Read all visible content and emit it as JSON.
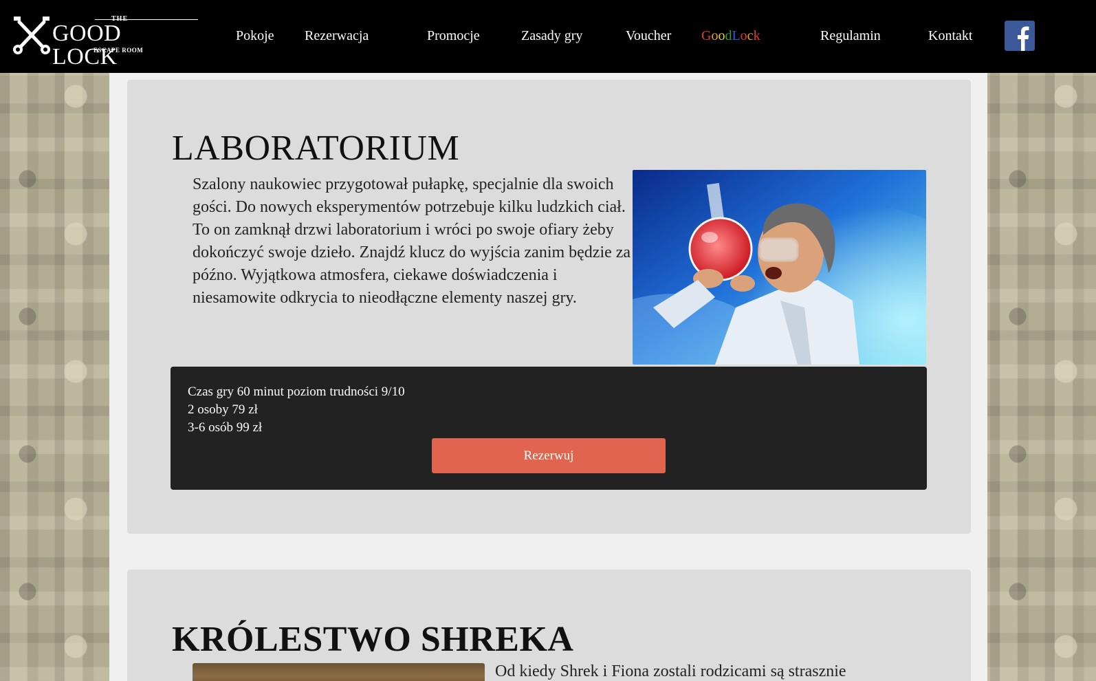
{
  "brand": {
    "the": "THE",
    "name": "GOOD LOCK",
    "sub": "ESCAPE ROOM"
  },
  "nav": {
    "items": [
      {
        "label": "Pokoje"
      },
      {
        "label": "Rezerwacja"
      },
      {
        "label": "Promocje"
      },
      {
        "label": "Zasady gry"
      },
      {
        "label": "Voucher"
      },
      {
        "label": "GoodLock",
        "letters": [
          "G",
          "o",
          "o",
          "d",
          "L",
          "o",
          "c",
          "k"
        ],
        "colors": [
          "#e03a2f",
          "#e8a020",
          "#f0d020",
          "#2a9a3a",
          "#1f5fd8",
          "#e03a2f",
          "#e8a020",
          "#e03a2f"
        ]
      },
      {
        "label": "Regulamin"
      },
      {
        "label": "Kontakt"
      }
    ],
    "social": "facebook-icon"
  },
  "rooms": [
    {
      "title": "LABORATORIUM",
      "description": "Szalony naukowiec przygotował pułapkę, specjalnie dla swoich gości. Do nowych eksperymentów potrzebuje kilku ludzkich ciał. To on zamknął drzwi laboratorium i wróci po swoje ofiary żeby dokończyć swoje dzieło. Znajdź klucz do wyjścia zanim będzie za późno. Wyjątkowa atmosfera, ciekawe doświadczenia i niesamowite odkrycia to nieodłączne elementy naszej gry.",
      "info": [
        "Czas gry 60 minut poziom trudności 9/10",
        "2 osoby 79 zł",
        "3-6 osób 99 zł"
      ],
      "button": "Rezerwuj"
    },
    {
      "title": "KRÓLESTWO SHREKA",
      "description": "Od kiedy Shrek i Fiona zostali rodzicami są strasznie"
    }
  ],
  "colors": {
    "header": "#000000",
    "card": "#dcdcdc",
    "info_box": "#222222",
    "button": "#e0644e",
    "facebook": "#3b5998"
  }
}
